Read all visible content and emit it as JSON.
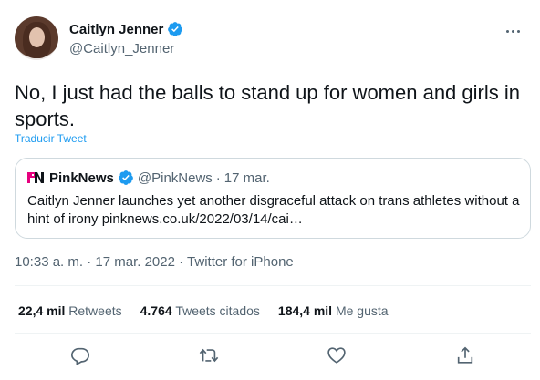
{
  "author": {
    "display_name": "Caitlyn Jenner",
    "handle": "@Caitlyn_Jenner",
    "verified_icon": "verified-badge-icon"
  },
  "tweet": {
    "text": "No, I just had the balls to stand up for women and girls in sports.",
    "translate_label": "Traducir Tweet"
  },
  "quoted": {
    "name": "PinkNews",
    "handle": "@PinkNews",
    "sep": "·",
    "date": "17 mar.",
    "body": "Caitlyn Jenner launches yet another disgraceful attack on trans athletes without a hint of irony pinknews.co.uk/2022/03/14/cai…"
  },
  "meta": {
    "time": "10:33 a. m.",
    "sep1": "·",
    "date": "17 mar. 2022",
    "sep2": "·",
    "source": "Twitter for iPhone"
  },
  "stats": {
    "retweets_count": "22,4 mil",
    "retweets_label": "Retweets",
    "quotes_count": "4.764",
    "quotes_label": "Tweets citados",
    "likes_count": "184,4 mil",
    "likes_label": "Me gusta"
  },
  "colors": {
    "accent": "#1d9bf0",
    "secondary_text": "#536471",
    "border": "#cfd9de"
  },
  "actions": [
    "reply-icon",
    "retweet-icon",
    "like-icon",
    "share-icon"
  ]
}
